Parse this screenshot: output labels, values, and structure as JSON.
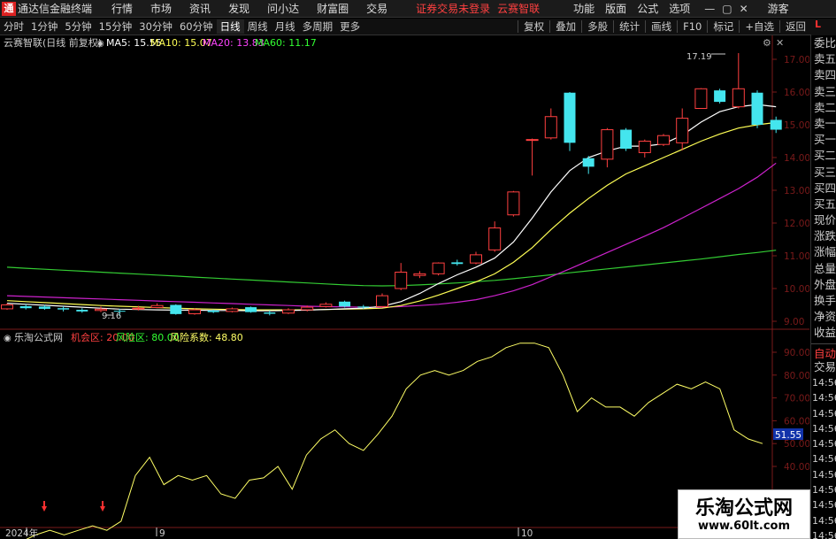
{
  "titlebar": {
    "app_title": "通达信金融终端",
    "logo_glyph": "通",
    "menus": [
      "行情",
      "市场",
      "资讯",
      "发现",
      "问小达",
      "财富圈",
      "交易"
    ],
    "warning": "证券交易未登录",
    "brand": "云赛智联",
    "right_menus": [
      "功能",
      "版面",
      "公式",
      "选项"
    ],
    "guest": "游客"
  },
  "toolbar": {
    "periods": [
      "分时",
      "1分钟",
      "5分钟",
      "15分钟",
      "30分钟",
      "60分钟",
      "日线",
      "周线",
      "月线",
      "多周期",
      "更多"
    ],
    "active_period": "日线",
    "right_items": [
      "复权",
      "叠加",
      "多股",
      "统计",
      "画线",
      "F10",
      "标记",
      "+自选",
      "返回"
    ],
    "l_badge": "L"
  },
  "main_chart": {
    "stock_label": "云赛智联(日线 前复权)",
    "ma": [
      {
        "label": "MA5: 15.55",
        "color": "#ffffff"
      },
      {
        "label": "MA10: 15.07",
        "color": "#ffff55"
      },
      {
        "label": "MA20: 13.83",
        "color": "#ff44ff"
      },
      {
        "label": "MA60: 11.17",
        "color": "#33ff33"
      }
    ],
    "high_label": "17.19",
    "low_label": "9.16",
    "price_ticks": [
      "17.00",
      "16.00",
      "15.00",
      "14.00",
      "13.00",
      "12.00",
      "11.00",
      "10.00",
      "9.00"
    ]
  },
  "sub_chart": {
    "title": "乐淘公式网",
    "items": [
      {
        "label": "机会区: 20.00",
        "color": "#ff4040"
      },
      {
        "label": "风险区: 80.00",
        "color": "#33ff33"
      },
      {
        "label": "风险系数: 48.80",
        "color": "#ffff66"
      }
    ],
    "ticks": [
      "90.00",
      "80.00",
      "70.00",
      "60.00",
      "50.00",
      "40.00"
    ],
    "current_value": "51.55"
  },
  "x_axis": {
    "labels": [
      "2024年",
      "9",
      "10"
    ]
  },
  "side_panel": {
    "items": [
      "委比",
      "卖五",
      "卖四",
      "卖三",
      "卖二",
      "卖一",
      "买一",
      "买二",
      "买三",
      "买四",
      "买五",
      "现价",
      "涨跌",
      "涨幅",
      "总量",
      "外盘",
      "换手",
      "净资",
      "收益"
    ],
    "auto_label": "自动",
    "trade_label": "交易",
    "times": [
      "14:56",
      "14:56",
      "14:56",
      "14:56",
      "14:56",
      "14:56",
      "14:56",
      "14:56",
      "14:56",
      "14:56",
      "14:56"
    ]
  },
  "watermark": {
    "title": "乐淘公式网",
    "url": "www.60lt.com"
  },
  "chart_data": {
    "type": "candlestick",
    "candles": [
      [
        9.38,
        9.5,
        9.55,
        9.35
      ],
      [
        9.46,
        9.4,
        9.52,
        9.36
      ],
      [
        9.45,
        9.38,
        9.5,
        9.35
      ],
      [
        9.4,
        9.36,
        9.46,
        9.3
      ],
      [
        9.35,
        9.3,
        9.4,
        9.26
      ],
      [
        9.33,
        9.37,
        9.45,
        9.28
      ],
      [
        9.32,
        9.3,
        9.38,
        9.16
      ],
      [
        9.38,
        9.4,
        9.47,
        9.33
      ],
      [
        9.42,
        9.48,
        9.55,
        9.4
      ],
      [
        9.5,
        9.22,
        9.52,
        9.2
      ],
      [
        9.23,
        9.35,
        9.4,
        9.2
      ],
      [
        9.33,
        9.28,
        9.36,
        9.25
      ],
      [
        9.3,
        9.38,
        9.42,
        9.27
      ],
      [
        9.43,
        9.28,
        9.45,
        9.26
      ],
      [
        9.27,
        9.23,
        9.33,
        9.18
      ],
      [
        9.25,
        9.35,
        9.4,
        9.22
      ],
      [
        9.35,
        9.43,
        9.48,
        9.3
      ],
      [
        9.45,
        9.52,
        9.58,
        9.42
      ],
      [
        9.6,
        9.45,
        9.63,
        9.42
      ],
      [
        9.45,
        9.42,
        9.5,
        9.38
      ],
      [
        9.45,
        9.78,
        9.85,
        9.43
      ],
      [
        10.0,
        10.5,
        10.78,
        9.95
      ],
      [
        10.4,
        10.45,
        10.53,
        10.32
      ],
      [
        10.45,
        10.78,
        10.8,
        10.4
      ],
      [
        10.8,
        10.75,
        10.88,
        10.7
      ],
      [
        10.78,
        11.03,
        11.12,
        10.74
      ],
      [
        11.18,
        11.85,
        12.05,
        11.12
      ],
      [
        12.25,
        12.95,
        12.98,
        12.2
      ],
      [
        14.55,
        14.55,
        14.58,
        13.45
      ],
      [
        14.6,
        15.25,
        15.5,
        14.55
      ],
      [
        15.98,
        14.45,
        16.0,
        14.2
      ],
      [
        13.98,
        13.72,
        14.05,
        13.5
      ],
      [
        13.95,
        14.85,
        14.9,
        13.7
      ],
      [
        14.85,
        14.27,
        14.9,
        14.2
      ],
      [
        14.15,
        14.5,
        14.55,
        14.0
      ],
      [
        14.4,
        14.67,
        14.72,
        14.35
      ],
      [
        14.45,
        15.2,
        15.5,
        14.22
      ],
      [
        15.5,
        16.1,
        16.12,
        15.5
      ],
      [
        16.05,
        15.7,
        16.1,
        15.65
      ],
      [
        15.55,
        16.1,
        17.19,
        15.5
      ],
      [
        15.98,
        15.0,
        16.05,
        14.9
      ],
      [
        15.15,
        14.85,
        15.25,
        14.75
      ]
    ],
    "ma5": [
      9.55,
      9.52,
      9.49,
      9.46,
      9.43,
      9.4,
      9.37,
      9.36,
      9.35,
      9.34,
      9.34,
      9.33,
      9.33,
      9.32,
      9.32,
      9.33,
      9.34,
      9.36,
      9.38,
      9.4,
      9.46,
      9.6,
      9.85,
      10.15,
      10.42,
      10.65,
      10.93,
      11.42,
      12.15,
      12.95,
      13.6,
      14.0,
      14.2,
      14.35,
      14.35,
      14.42,
      14.68,
      15.08,
      15.4,
      15.55,
      15.62,
      15.55
    ],
    "ma10": [
      9.63,
      9.6,
      9.57,
      9.54,
      9.51,
      9.48,
      9.46,
      9.44,
      9.42,
      9.4,
      9.38,
      9.37,
      9.36,
      9.35,
      9.35,
      9.35,
      9.35,
      9.36,
      9.37,
      9.38,
      9.4,
      9.48,
      9.62,
      9.8,
      10.0,
      10.2,
      10.45,
      10.8,
      11.25,
      11.8,
      12.3,
      12.75,
      13.15,
      13.5,
      13.75,
      14.0,
      14.25,
      14.5,
      14.72,
      14.9,
      15.0,
      15.07
    ],
    "ma20": [
      9.78,
      9.76,
      9.74,
      9.72,
      9.7,
      9.68,
      9.66,
      9.64,
      9.62,
      9.6,
      9.58,
      9.56,
      9.54,
      9.52,
      9.5,
      9.48,
      9.46,
      9.45,
      9.44,
      9.43,
      9.43,
      9.45,
      9.48,
      9.52,
      9.58,
      9.66,
      9.78,
      9.93,
      10.12,
      10.36,
      10.6,
      10.85,
      11.1,
      11.35,
      11.6,
      11.86,
      12.15,
      12.45,
      12.75,
      13.05,
      13.4,
      13.83
    ],
    "ma60": [
      10.65,
      10.62,
      10.59,
      10.56,
      10.53,
      10.5,
      10.47,
      10.44,
      10.41,
      10.38,
      10.35,
      10.32,
      10.29,
      10.26,
      10.23,
      10.2,
      10.17,
      10.14,
      10.11,
      10.09,
      10.08,
      10.09,
      10.11,
      10.14,
      10.17,
      10.21,
      10.25,
      10.3,
      10.36,
      10.42,
      10.48,
      10.54,
      10.6,
      10.66,
      10.72,
      10.78,
      10.84,
      10.9,
      10.97,
      11.04,
      11.1,
      11.17
    ],
    "risk_coefficient": [
      8,
      7,
      10,
      12,
      10,
      12,
      14,
      12,
      16,
      36,
      44,
      32,
      36,
      34,
      36,
      28,
      26,
      34,
      35,
      40,
      30,
      45,
      52,
      56,
      50,
      47,
      54,
      62,
      74,
      80,
      82,
      80,
      82,
      86,
      88,
      92,
      94,
      94,
      92,
      80,
      64,
      70,
      66,
      66,
      62,
      68,
      72,
      76,
      74,
      77,
      74,
      56,
      52,
      50
    ]
  }
}
